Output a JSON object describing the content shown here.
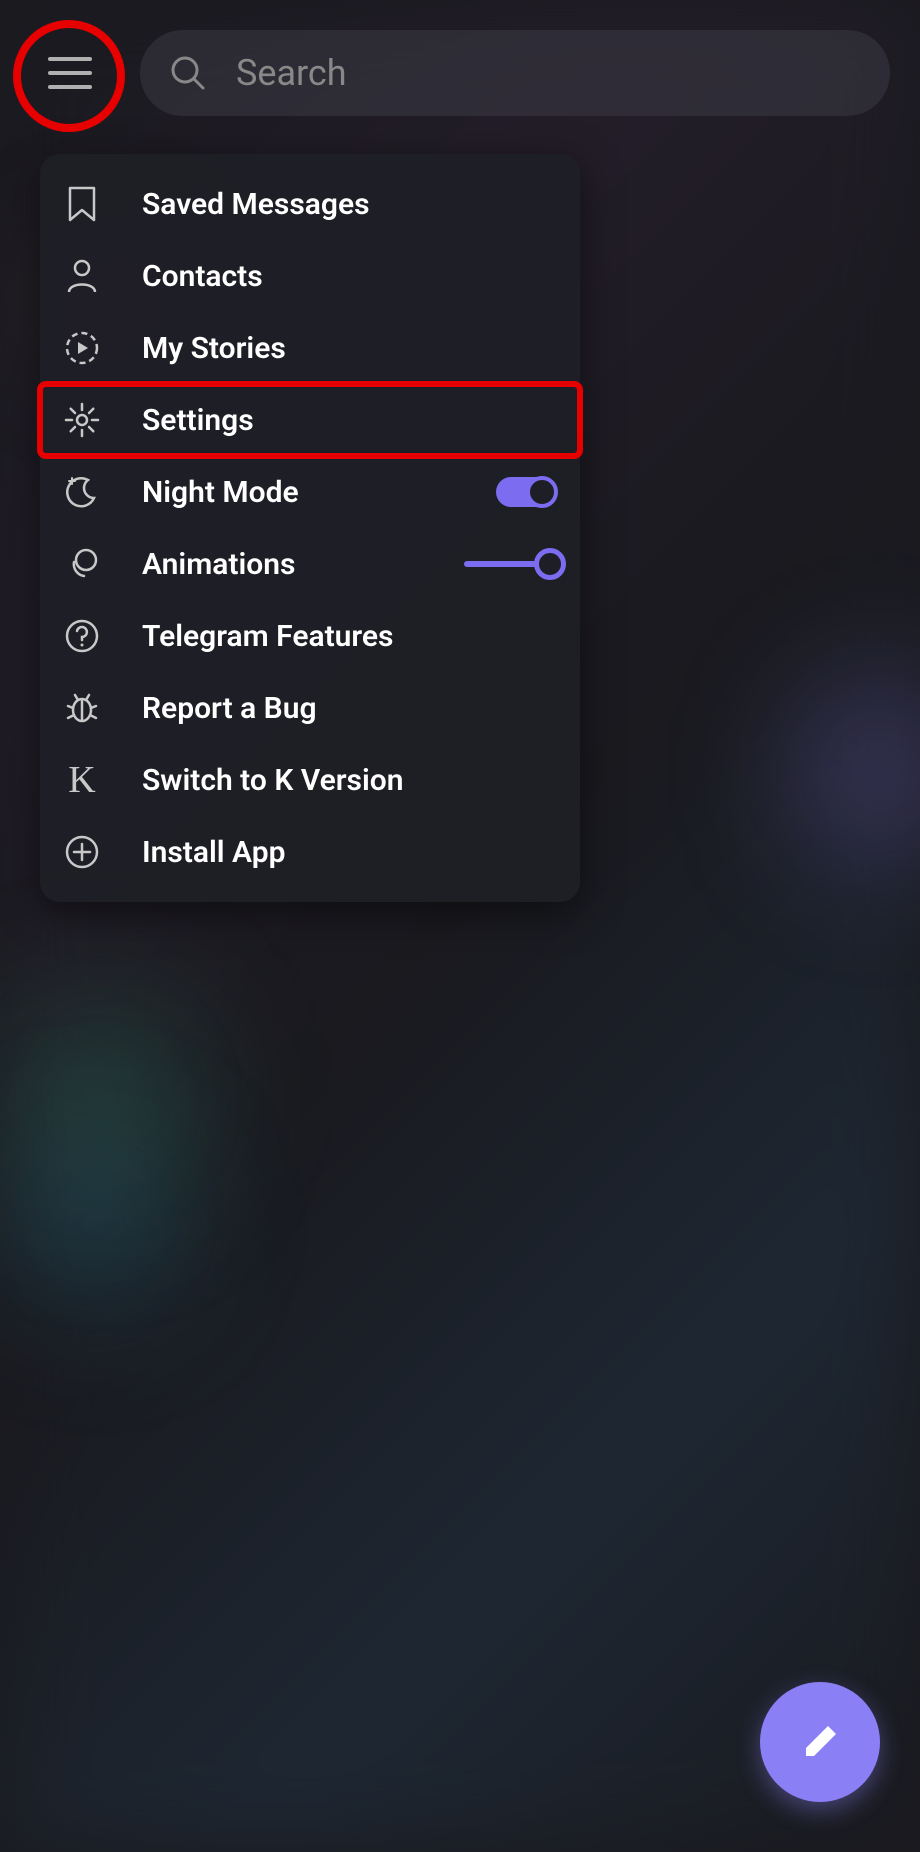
{
  "search": {
    "placeholder": "Search"
  },
  "menu": {
    "saved_messages": "Saved Messages",
    "contacts": "Contacts",
    "my_stories": "My Stories",
    "settings": "Settings",
    "night_mode": "Night Mode",
    "animations": "Animations",
    "telegram_features": "Telegram Features",
    "report_bug": "Report a Bug",
    "switch_k": "Switch to K Version",
    "install_app": "Install App"
  },
  "toggles": {
    "night_mode": true,
    "animations": 1.0
  },
  "colors": {
    "accent": "#7b6cf0",
    "highlight": "#e60000",
    "fab": "#8b7ff5"
  }
}
